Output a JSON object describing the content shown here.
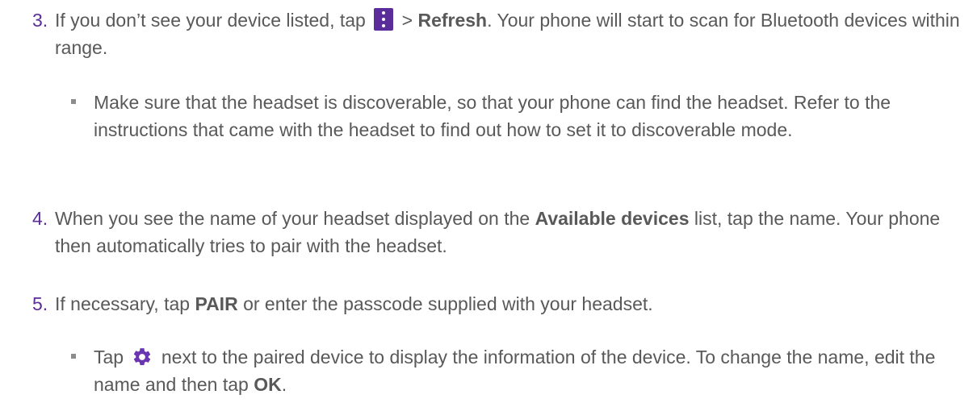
{
  "steps": [
    {
      "num": "3.",
      "t1": "If you don’t see your device listed, tap ",
      "t2": " > ",
      "b1": "Refresh",
      "t3": ". Your phone will start to scan for Bluetooth devices within range."
    },
    {
      "num": "4.",
      "t1": "When you see the name of your headset displayed on the ",
      "b1": "Available devices",
      "t2": " list, tap the name. Your phone then automatically tries to pair with the headset."
    },
    {
      "num": "5.",
      "t1": "If necessary, tap ",
      "b1": "PAIR",
      "t2": " or enter the passcode supplied with your headset."
    }
  ],
  "subs": [
    {
      "text": "Make sure that the headset is discoverable, so that your phone can find the headset. Refer to the instructions that came with the headset to find out how to set it to discoverable mode."
    },
    {
      "t1": "Tap ",
      "t2": " next to the paired device to display the information of the device. To change the name, edit the name and then tap ",
      "b1": "OK",
      "t3": "."
    }
  ],
  "icons": {
    "menu": "more-vert-icon",
    "settings": "gear-icon"
  },
  "colors": {
    "text": "#595959",
    "accent": "#5b2d9a",
    "bullet": "#8c8c8c"
  }
}
